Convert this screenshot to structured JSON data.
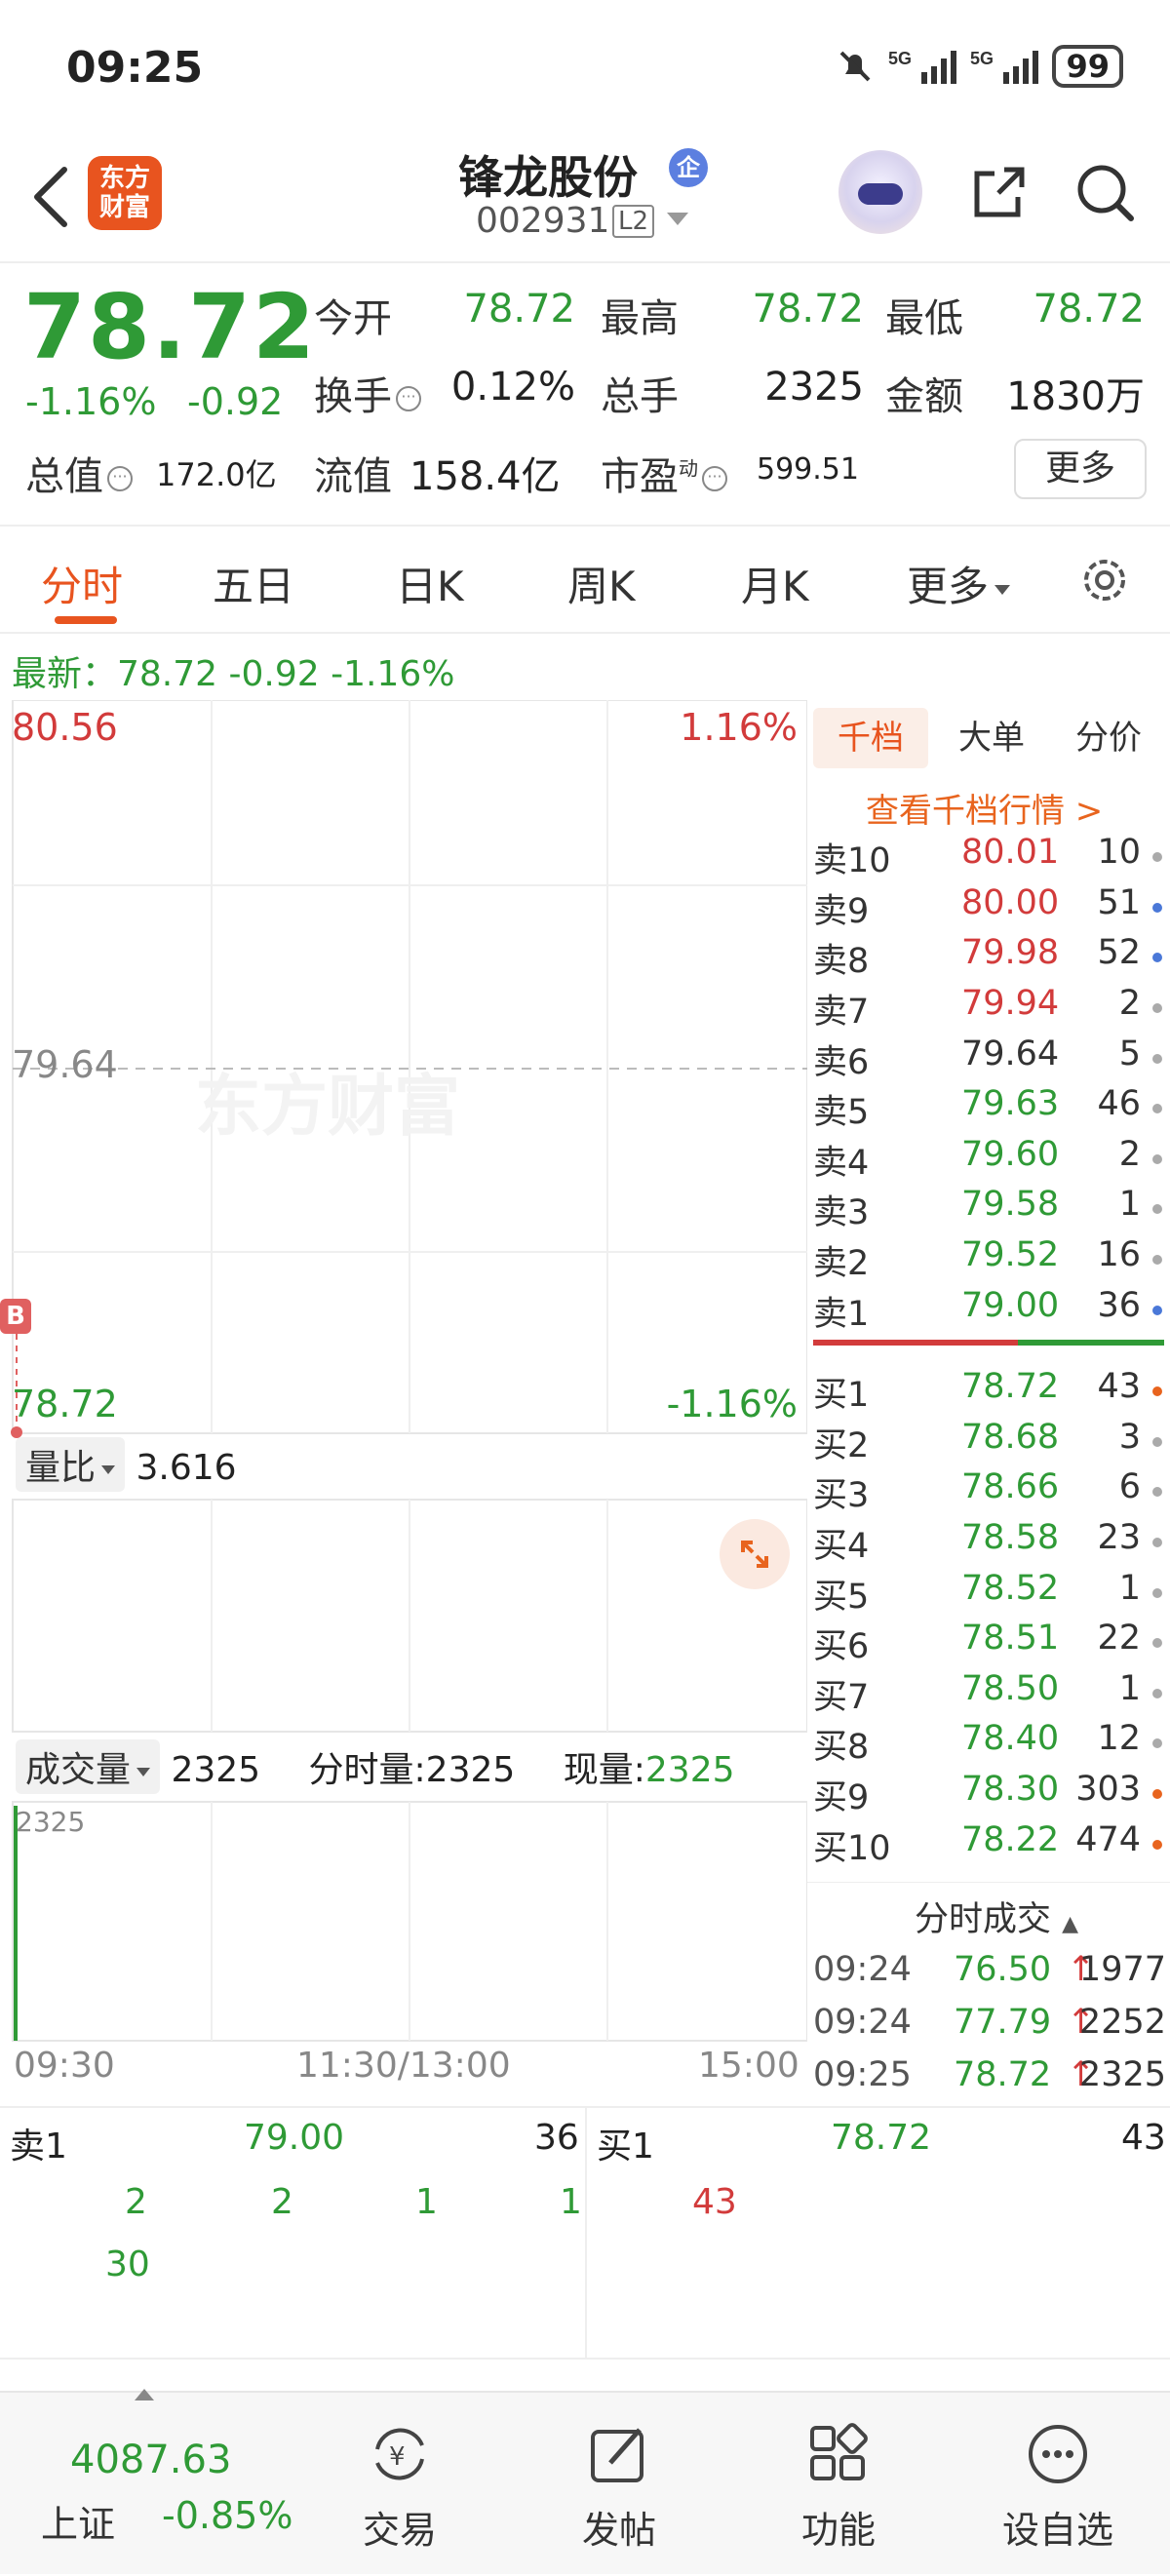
{
  "status_bar": {
    "time": "09:25",
    "battery": "99"
  },
  "header": {
    "app_logo_line1": "东方",
    "app_logo_line2": "财富",
    "stock_name": "锋龙股份",
    "badge": "企",
    "stock_code": "002931",
    "level_tag": "L2"
  },
  "quote": {
    "last_price": "78.72",
    "change_pct": "-1.16%",
    "change_abs": "-0.92",
    "open_label": "今开",
    "open": "78.72",
    "high_label": "最高",
    "high": "78.72",
    "low_label": "最低",
    "low": "78.72",
    "turnover_label": "换手",
    "turnover": "0.12%",
    "volume_label": "总手",
    "volume": "2325",
    "amount_label": "金额",
    "amount": "1830万",
    "mktcap_label": "总值",
    "mktcap": "172.0亿",
    "float_label": "流值",
    "float_cap": "158.4亿",
    "pe_label": "市盈",
    "pe_sup": "动",
    "pe": "599.51",
    "more_label": "更多"
  },
  "tabs": [
    "分时",
    "五日",
    "日K",
    "周K",
    "月K",
    "更多"
  ],
  "latest": {
    "text": "最新：78.72  -0.92  -1.16%"
  },
  "chart": {
    "top_price": "80.56",
    "top_pct": "1.16%",
    "mid_price": "79.64",
    "bottom_price": "78.72",
    "bottom_pct": "-1.16%",
    "watermark": "东方财富",
    "b_marker": "B",
    "ratio_label": "量比",
    "ratio_value": "3.616",
    "vol_label": "成交量",
    "vol_value": "2325",
    "vol_minute_label": "分时量:2325",
    "vol_now_label": "现量:",
    "vol_now_value": "2325",
    "vol_axis_top": "2325",
    "time_start": "09:30",
    "time_mid": "11:30/13:00",
    "time_end": "15:00"
  },
  "order_book": {
    "tabs": [
      "千档",
      "大单",
      "分价"
    ],
    "view_link": "查看千档行情 >",
    "asks": [
      {
        "label": "卖10",
        "price": "80.01",
        "vol": "10",
        "dot": "#aaaaaa",
        "color": "#d23b3b"
      },
      {
        "label": "卖9",
        "price": "80.00",
        "vol": "51",
        "dot": "#4a78d8",
        "color": "#d23b3b"
      },
      {
        "label": "卖8",
        "price": "79.98",
        "vol": "52",
        "dot": "#4a78d8",
        "color": "#d23b3b"
      },
      {
        "label": "卖7",
        "price": "79.94",
        "vol": "2",
        "dot": "#aaaaaa",
        "color": "#d23b3b"
      },
      {
        "label": "卖6",
        "price": "79.64",
        "vol": "5",
        "dot": "#aaaaaa",
        "color": "#333333"
      },
      {
        "label": "卖5",
        "price": "79.63",
        "vol": "46",
        "dot": "#aaaaaa",
        "color": "#2f9a36"
      },
      {
        "label": "卖4",
        "price": "79.60",
        "vol": "2",
        "dot": "#aaaaaa",
        "color": "#2f9a36"
      },
      {
        "label": "卖3",
        "price": "79.58",
        "vol": "1",
        "dot": "#aaaaaa",
        "color": "#2f9a36"
      },
      {
        "label": "卖2",
        "price": "79.52",
        "vol": "16",
        "dot": "#aaaaaa",
        "color": "#2f9a36"
      },
      {
        "label": "卖1",
        "price": "79.00",
        "vol": "36",
        "dot": "#4a78d8",
        "color": "#2f9a36"
      }
    ],
    "bids": [
      {
        "label": "买1",
        "price": "78.72",
        "vol": "43",
        "dot": "#e8641e"
      },
      {
        "label": "买2",
        "price": "78.68",
        "vol": "3",
        "dot": "#aaaaaa"
      },
      {
        "label": "买3",
        "price": "78.66",
        "vol": "6",
        "dot": "#aaaaaa"
      },
      {
        "label": "买4",
        "price": "78.58",
        "vol": "23",
        "dot": "#aaaaaa"
      },
      {
        "label": "买5",
        "price": "78.52",
        "vol": "1",
        "dot": "#aaaaaa"
      },
      {
        "label": "买6",
        "price": "78.51",
        "vol": "22",
        "dot": "#aaaaaa"
      },
      {
        "label": "买7",
        "price": "78.50",
        "vol": "1",
        "dot": "#aaaaaa"
      },
      {
        "label": "买8",
        "price": "78.40",
        "vol": "12",
        "dot": "#aaaaaa"
      },
      {
        "label": "买9",
        "price": "78.30",
        "vol": "303",
        "dot": "#e8641e"
      },
      {
        "label": "买10",
        "price": "78.22",
        "vol": "474",
        "dot": "#e8641e"
      }
    ],
    "trades_title": "分时成交",
    "trades": [
      {
        "time": "09:24",
        "price": "76.50",
        "vol": "1977"
      },
      {
        "time": "09:24",
        "price": "77.79",
        "vol": "2252"
      },
      {
        "time": "09:25",
        "price": "78.72",
        "vol": "2325"
      }
    ]
  },
  "level_panel": {
    "ask_label": "卖1",
    "ask_price": "79.00",
    "ask_vol": "36",
    "bid_label": "买1",
    "bid_price": "78.72",
    "bid_vol": "43",
    "ask_orders": [
      "2",
      "2",
      "1",
      "1",
      "30"
    ],
    "bid_orders": [
      "43"
    ]
  },
  "bottom_nav": {
    "index_value": "4087.63",
    "index_name": "上证",
    "index_change": "-0.85%",
    "items": [
      "交易",
      "发帖",
      "功能",
      "设自选"
    ]
  }
}
